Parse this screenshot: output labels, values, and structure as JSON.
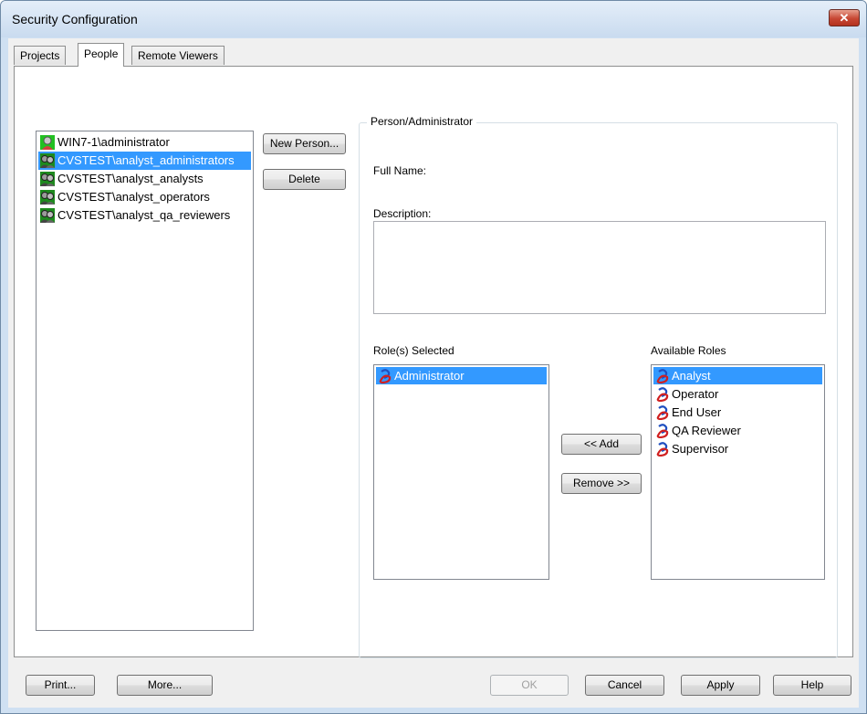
{
  "window": {
    "title": "Security Configuration",
    "close_glyph": "✕"
  },
  "tabs": [
    {
      "label": "Projects",
      "active": false
    },
    {
      "label": "People",
      "active": true
    },
    {
      "label": "Remote Viewers",
      "active": false
    }
  ],
  "people": {
    "items": [
      {
        "label": "WIN7-1\\administrator",
        "icon": "user-icon",
        "selected": false
      },
      {
        "label": "CVSTEST\\analyst_administrators",
        "icon": "group-icon",
        "selected": true
      },
      {
        "label": "CVSTEST\\analyst_analysts",
        "icon": "group-icon",
        "selected": false
      },
      {
        "label": "CVSTEST\\analyst_operators",
        "icon": "group-icon",
        "selected": false
      },
      {
        "label": "CVSTEST\\analyst_qa_reviewers",
        "icon": "group-icon",
        "selected": false
      }
    ],
    "new_person_label": "New Person...",
    "delete_label": "Delete"
  },
  "person_admin": {
    "group_title": "Person/Administrator",
    "full_name_label": "Full Name:",
    "full_name_value": "",
    "description_label": "Description:",
    "description_value": ""
  },
  "roles": {
    "selected_label": "Role(s) Selected",
    "selected_items": [
      {
        "label": "Administrator",
        "icon": "role-icon",
        "selected": true
      }
    ],
    "available_label": "Available Roles",
    "available_items": [
      {
        "label": "Analyst",
        "icon": "role-icon",
        "selected": true
      },
      {
        "label": "Operator",
        "icon": "role-icon",
        "selected": false
      },
      {
        "label": "End User",
        "icon": "role-icon",
        "selected": false
      },
      {
        "label": "QA Reviewer",
        "icon": "role-icon",
        "selected": false
      },
      {
        "label": "Supervisor",
        "icon": "role-icon",
        "selected": false
      }
    ],
    "add_label": "<< Add",
    "remove_label": "Remove >>"
  },
  "footer": {
    "print_label": "Print...",
    "more_label": "More...",
    "ok_label": "OK",
    "cancel_label": "Cancel",
    "apply_label": "Apply",
    "help_label": "Help"
  },
  "colors": {
    "selection": "#3399ff",
    "titlebar": "#c9dbef",
    "close_button": "#c74733",
    "user_icon_bg": "#22c022",
    "role_icon_red": "#d02020",
    "role_icon_blue": "#2050c0"
  }
}
